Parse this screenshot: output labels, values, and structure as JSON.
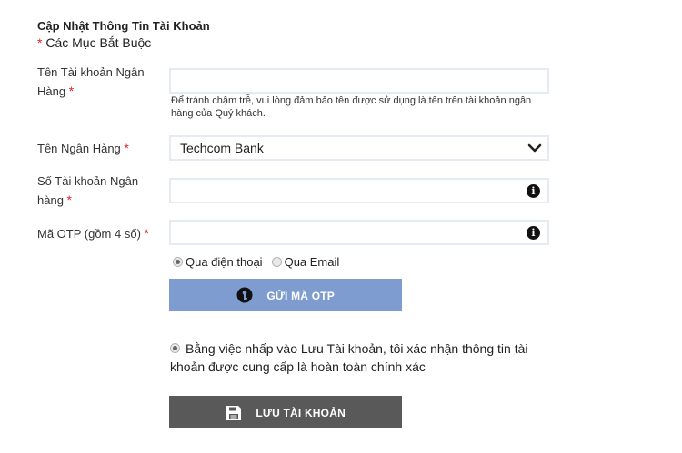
{
  "header": {
    "title": "Cập Nhật Thông Tin Tài Khoản",
    "required_note": "Các Mục Bắt Buộc",
    "required_mark": "*"
  },
  "fields": {
    "account_name": {
      "label_line1": "Tên Tài khoản Ngân",
      "label_line2": "Hàng",
      "value": "",
      "hint": "Để tránh chậm trễ, vui lòng đảm bảo tên được sử dụng là tên trên tài khoản ngân hàng của Quý khách."
    },
    "bank_name": {
      "label": "Tên Ngân Hàng",
      "selected": "Techcom Bank"
    },
    "account_number": {
      "label_line1": "Số Tài khoản Ngân",
      "label_line2": "hàng",
      "value": ""
    },
    "otp": {
      "label": "Mã OTP (gồm 4 số)",
      "value": ""
    }
  },
  "otp_method": {
    "options": [
      {
        "label": "Qua điện thoại",
        "selected": true
      },
      {
        "label": "Qua Email",
        "selected": false
      }
    ]
  },
  "buttons": {
    "send_otp": "GỬI MÃ OTP",
    "save_account": "LƯU TÀI KHOẢN"
  },
  "agreement": {
    "text": "Bằng việc nhấp vào Lưu Tài khoản, tôi xác nhận thông tin tài khoản được cung cấp là hoàn toàn chính xác"
  },
  "icons": {
    "info": "i",
    "select_arrow": "chevron-down-icon",
    "key": "key-icon",
    "save": "save-icon"
  },
  "colors": {
    "required": "#d9252b",
    "otp_button": "#7e9ccf",
    "save_button": "#595959",
    "input_border": "#e5eaf3"
  }
}
